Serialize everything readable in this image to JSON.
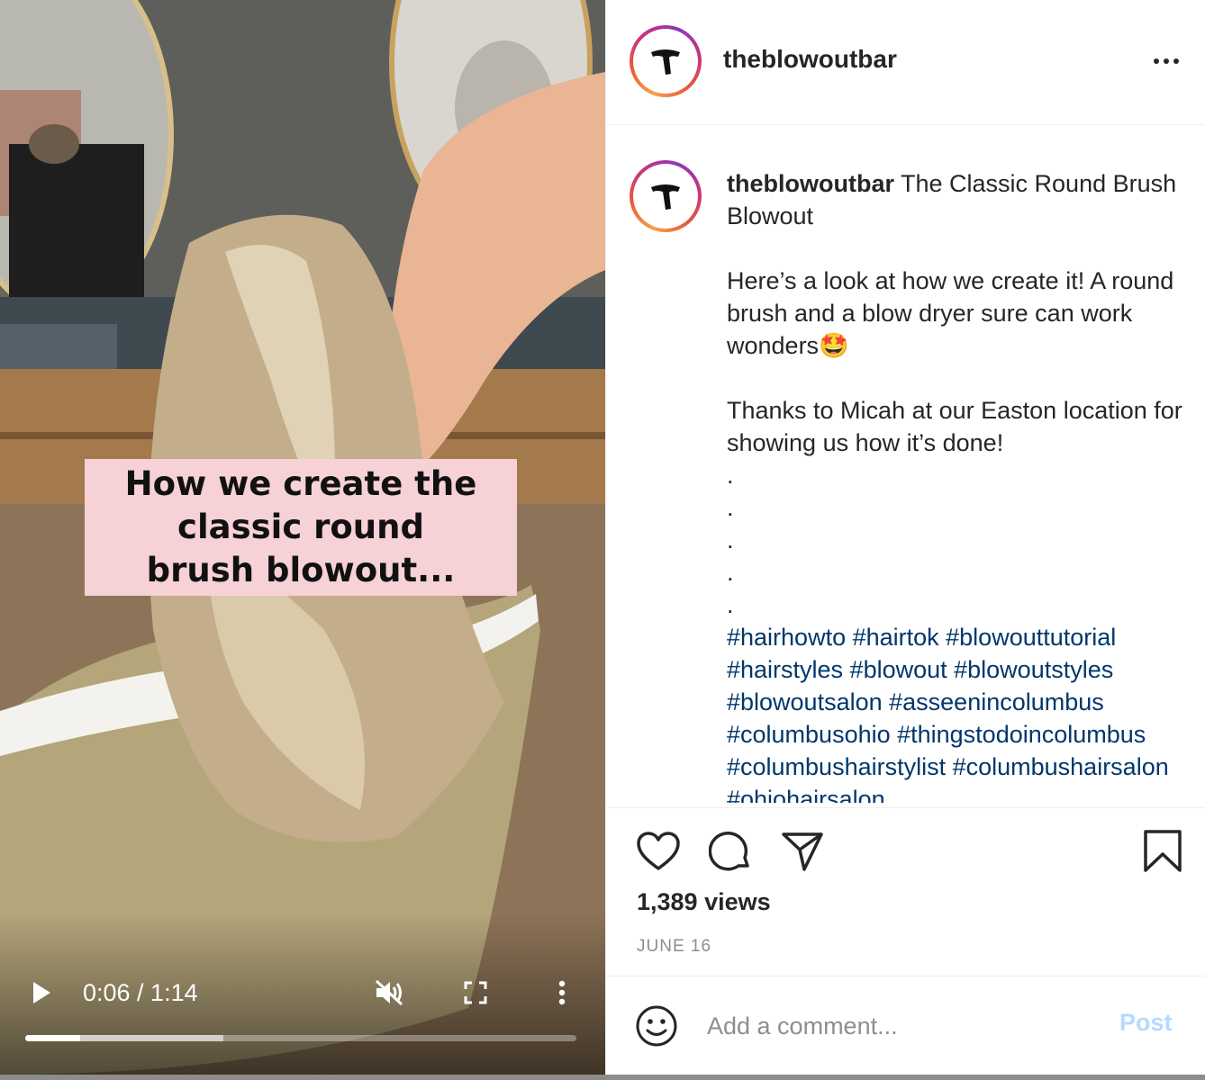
{
  "video": {
    "overlay_caption": "How we create the classic round brush blowout...",
    "current_time": "0:06",
    "duration": "1:14",
    "time_display": "0:06 / 1:14",
    "played_fraction": 0.1,
    "buffered_fraction": 0.36,
    "muted": true,
    "icons": {
      "play": "play-icon",
      "mute": "volume-muted-icon",
      "fullscreen": "fullscreen-icon",
      "more": "more-vertical-icon"
    }
  },
  "post": {
    "username": "theblowoutbar",
    "caption": {
      "username": "theblowoutbar",
      "title": "The Classic Round Brush Blowout",
      "paragraph1": "Here’s a look at how we create it! A round brush and a blow dryer sure can work wonders🤩",
      "paragraph2": "Thanks to Micah at our Easton location for showing us how it’s done!",
      "dots": [
        ".",
        ".",
        ".",
        ".",
        "."
      ],
      "hashtags": "#hairhowto #hairtok #blowouttutorial #hairstyles #blowout #blowoutstyles #blowoutsalon #asseenincolumbus #columbusohio #thingstodoincolumbus #columbushairstylist #columbushairsalon #ohiohairsalon"
    },
    "views": "1,389 views",
    "date": "JUNE 16",
    "comment_placeholder": "Add a comment...",
    "post_label": "Post",
    "colors": {
      "hashtag": "#00376b",
      "post_button": "#b3dbff",
      "overlay_bg": "#f6d1d6",
      "muted_text": "#8e8e8e"
    },
    "icons": {
      "header_more": "more-horizontal-icon",
      "like": "heart-icon",
      "comment": "comment-bubble-icon",
      "share": "paper-plane-icon",
      "save": "bookmark-icon",
      "emoji": "smiley-icon",
      "avatar": "hair-dryer-logo-icon"
    }
  }
}
